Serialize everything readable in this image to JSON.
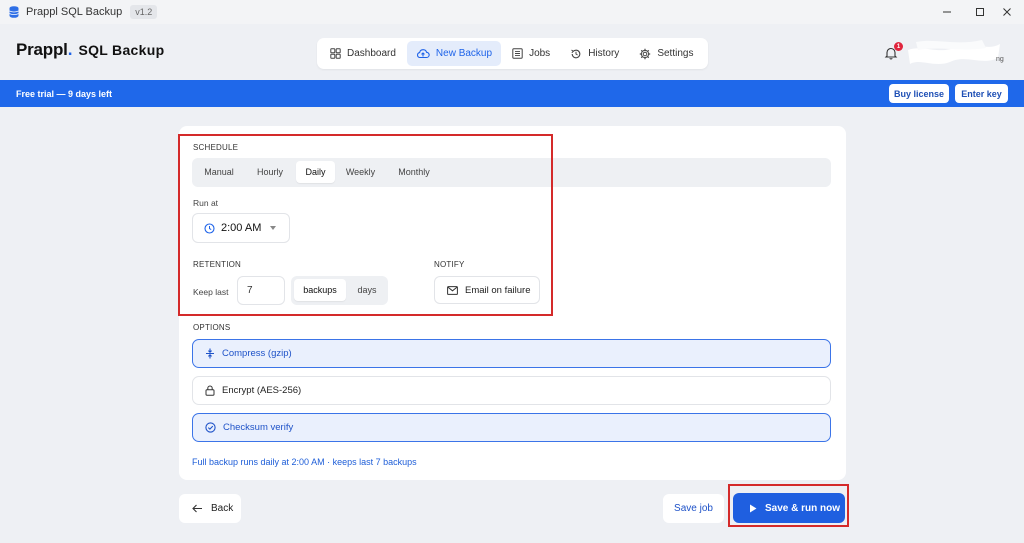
{
  "window": {
    "app_name": "Prappl SQL Backup",
    "version": "v1.2",
    "controls": {
      "minimize": "—",
      "maximize": "☐",
      "close": "✕"
    }
  },
  "header": {
    "logo_brand": "Prappl",
    "logo_dot": ".",
    "logo_product": "SQL Backup",
    "nav": [
      {
        "label": "Dashboard",
        "icon": "grid-icon",
        "active": false
      },
      {
        "label": "New Backup",
        "icon": "cloud-upload-icon",
        "active": true
      },
      {
        "label": "Jobs",
        "icon": "list-icon",
        "active": false
      },
      {
        "label": "History",
        "icon": "history-icon",
        "active": false
      },
      {
        "label": "Settings",
        "icon": "gear-icon",
        "active": false
      }
    ],
    "notification_count": "1",
    "user_suffix": "ng"
  },
  "banner": {
    "text": "Free trial — 9 days left",
    "buy_label": "Buy license",
    "key_label": "Enter key"
  },
  "schedule": {
    "section_label": "SCHEDULE",
    "frequencies": [
      "Manual",
      "Hourly",
      "Daily",
      "Weekly",
      "Monthly"
    ],
    "selected_frequency": "Daily",
    "run_at_label": "Run at",
    "run_at_value": "2:00 AM"
  },
  "retention": {
    "section_label": "RETENTION",
    "keep_last_label": "Keep last",
    "keep_last_value": "7",
    "units": [
      "backups",
      "days"
    ],
    "selected_unit": "backups"
  },
  "notify": {
    "section_label": "NOTIFY",
    "email_on_failure_label": "Email on failure"
  },
  "options": {
    "section_label": "OPTIONS",
    "items": [
      {
        "label": "Compress (gzip)",
        "icon": "compress-icon",
        "enabled": true
      },
      {
        "label": "Encrypt (AES-256)",
        "icon": "lock-icon",
        "enabled": false
      },
      {
        "label": "Checksum verify",
        "icon": "check-circle-icon",
        "enabled": true
      }
    ]
  },
  "summary": "Full backup runs daily at 2:00 AM · keeps last 7 backups",
  "footer": {
    "back_label": "Back",
    "save_job_label": "Save job",
    "save_run_label": "Save & run now"
  },
  "colors": {
    "accent": "#1f68ea",
    "primary_button": "#1f5fe0",
    "highlight_box": "#d42a2a",
    "badge": "#e0253d"
  }
}
